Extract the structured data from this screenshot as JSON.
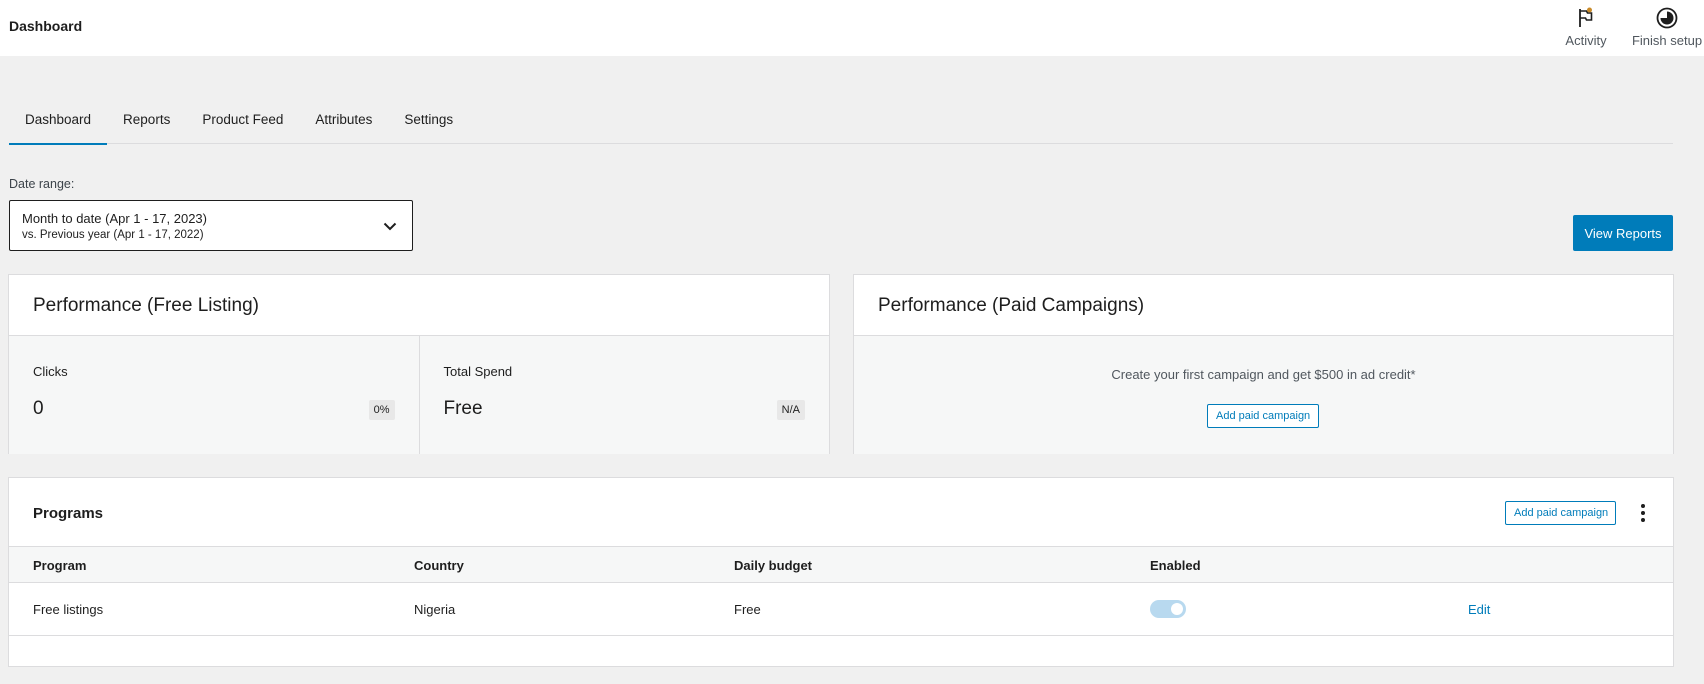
{
  "header": {
    "title": "Dashboard",
    "actions": [
      {
        "label": "Activity",
        "icon": "flag-icon"
      },
      {
        "label": "Finish setup",
        "icon": "progress-circle-icon"
      }
    ]
  },
  "tabs": [
    {
      "label": "Dashboard",
      "active": true
    },
    {
      "label": "Reports",
      "active": false
    },
    {
      "label": "Product Feed",
      "active": false
    },
    {
      "label": "Attributes",
      "active": false
    },
    {
      "label": "Settings",
      "active": false
    }
  ],
  "date_range": {
    "label": "Date range:",
    "primary": "Month to date (Apr 1 - 17, 2023)",
    "secondary": "vs. Previous year (Apr 1 - 17, 2022)"
  },
  "view_reports_label": "View Reports",
  "free_listing": {
    "title": "Performance (Free Listing)",
    "metrics": [
      {
        "label": "Clicks",
        "value": "0",
        "badge": "0%"
      },
      {
        "label": "Total Spend",
        "value": "Free",
        "badge": "N/A"
      }
    ]
  },
  "paid_campaigns": {
    "title": "Performance (Paid Campaigns)",
    "promo": "Create your first campaign and get $500 in ad credit*",
    "button": "Add paid campaign"
  },
  "programs": {
    "title": "Programs",
    "add_button": "Add paid campaign",
    "columns": [
      "Program",
      "Country",
      "Daily budget",
      "Enabled"
    ],
    "rows": [
      {
        "program": "Free listings",
        "country": "Nigeria",
        "budget": "Free",
        "enabled": true,
        "action": "Edit"
      }
    ]
  },
  "colors": {
    "accent": "#007cba",
    "background": "#f0f0f0",
    "toggle_disabled_on": "#b8d9ef",
    "activity_dot": "#c98b2a"
  }
}
